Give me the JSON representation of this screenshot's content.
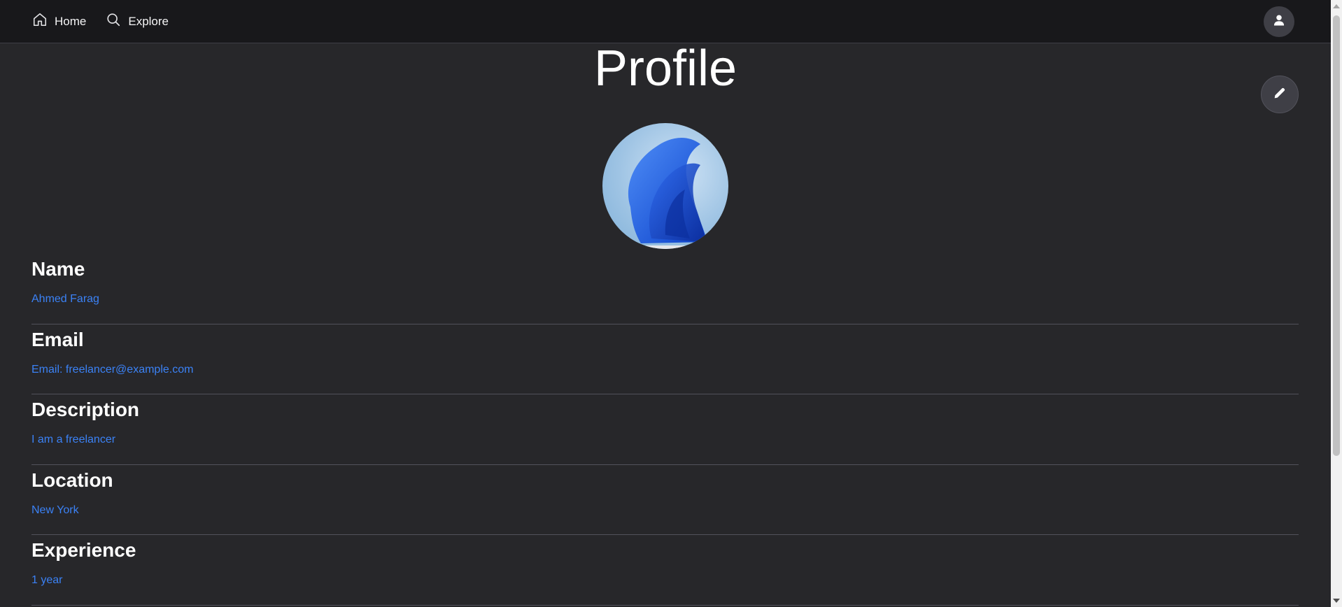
{
  "nav": {
    "home_label": "Home",
    "explore_label": "Explore",
    "home_icon": "home-icon",
    "explore_icon": "search-icon",
    "user_icon": "user-icon"
  },
  "page": {
    "title": "Profile",
    "edit_icon": "pencil-icon"
  },
  "fields": [
    {
      "label": "Name",
      "value": "Ahmed Farag"
    },
    {
      "label": "Email",
      "value": "Email: freelancer@example.com"
    },
    {
      "label": "Description",
      "value": "I am a freelancer"
    },
    {
      "label": "Location",
      "value": "New York"
    },
    {
      "label": "Experience",
      "value": "1 year"
    }
  ],
  "colors": {
    "background": "#27272a",
    "navbar": "#18181b",
    "value_text": "#3b82f6",
    "button_bg": "#3f3f46"
  }
}
